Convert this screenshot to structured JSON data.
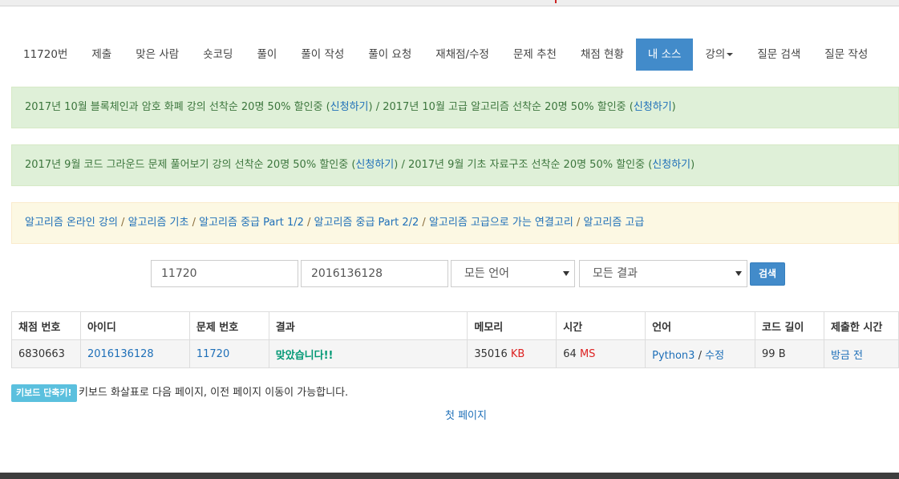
{
  "nav": {
    "items": [
      {
        "label": "11720번"
      },
      {
        "label": "제출"
      },
      {
        "label": "맞은 사람"
      },
      {
        "label": "숏코딩"
      },
      {
        "label": "풀이"
      },
      {
        "label": "풀이 작성"
      },
      {
        "label": "풀이 요청"
      },
      {
        "label": "재채점/수정"
      },
      {
        "label": "문제 추천"
      },
      {
        "label": "채점 현황"
      },
      {
        "label": "내 소스"
      },
      {
        "label": "강의"
      },
      {
        "label": "질문 검색"
      },
      {
        "label": "질문 작성"
      }
    ],
    "active": "내 소스"
  },
  "alerts": {
    "a1": {
      "text1": "2017년 10월 블록체인과 암호 화폐 강의 선착순 20명 50% 할인중 (",
      "link1": "신청하기",
      "text2": ") / 2017년 10월 고급 알고리즘 선착순 20명 50% 할인중 (",
      "link2": "신청하기",
      "text3": ")"
    },
    "a2": {
      "text1": "2017년 9월 코드 그라운드 문제 풀어보기 강의 선착순 20명 50% 할인중 (",
      "link1": "신청하기",
      "text2": ") / 2017년 9월 기초 자료구조 선착순 20명 50% 할인중 (",
      "link2": "신청하기",
      "text3": ")"
    },
    "a3": {
      "links": [
        "알고리즘 온라인 강의",
        "알고리즘 기초",
        "알고리즘 중급 Part 1/2",
        "알고리즘 중급 Part 2/2",
        "알고리즘 고급으로 가는 연결고리",
        "알고리즘 고급"
      ],
      "sep": " / "
    }
  },
  "search": {
    "problem_value": "11720",
    "user_value": "2016136128",
    "language_selected": "모든 언어",
    "result_selected": "모든 결과",
    "button_label": "검색"
  },
  "table": {
    "headers": [
      "채점 번호",
      "아이디",
      "문제 번호",
      "결과",
      "메모리",
      "시간",
      "언어",
      "코드 길이",
      "제출한 시간"
    ],
    "row": {
      "submission_id": "6830663",
      "user_id": "2016136128",
      "problem_id": "11720",
      "result": "맞았습니다!!",
      "memory": "35016",
      "memory_unit": "KB",
      "time": "64",
      "time_unit": "MS",
      "language": "Python3",
      "lang_sep": " / ",
      "edit": "수정",
      "code_length": "99 B",
      "submitted": "방금 전"
    }
  },
  "footer": {
    "kbd_label": "키보드 단축키!",
    "kbd_text": "키보드 화살표로 다음 페이지, 이전 페이지 이동이 가능합니다.",
    "first_page": "첫 페이지"
  },
  "colors": {
    "accent": "#428bca",
    "link": "#1e6fb8",
    "success_bg": "#dff0d8",
    "warning_bg": "#fcf8e3",
    "result_ok": "#009874",
    "unit": "#dd2222",
    "info": "#5bc0de"
  }
}
